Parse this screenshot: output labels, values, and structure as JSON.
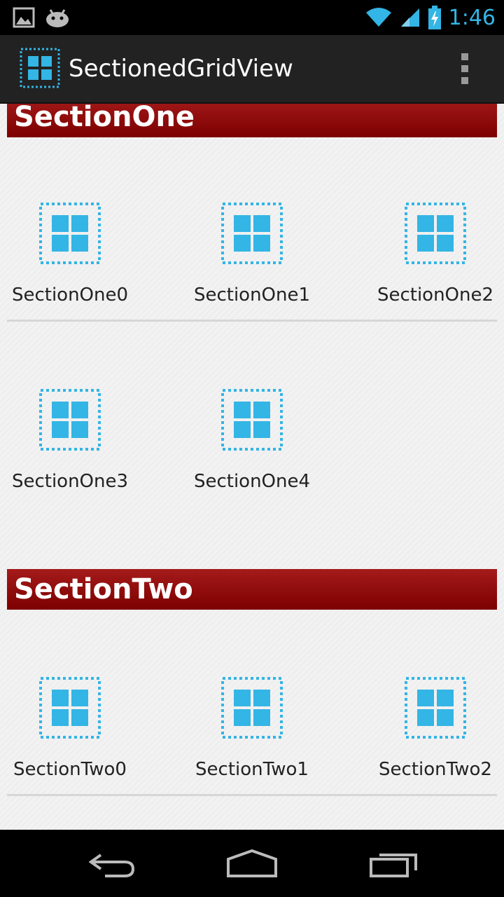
{
  "status_bar": {
    "time": "1:46",
    "icons": [
      "gallery-icon",
      "android-icon",
      "wifi-icon",
      "signal-icon",
      "battery-charging-icon"
    ]
  },
  "action_bar": {
    "title": "SectionedGridView",
    "app_icon": "grid-app-icon",
    "overflow_icon": "overflow-menu-icon"
  },
  "sections": [
    {
      "title": "SectionOne",
      "items": [
        "SectionOne0",
        "SectionOne1",
        "SectionOne2",
        "SectionOne3",
        "SectionOne4"
      ]
    },
    {
      "title": "SectionTwo",
      "items": [
        "SectionTwo0",
        "SectionTwo1",
        "SectionTwo2"
      ]
    }
  ],
  "nav_bar": {
    "back_icon": "back-icon",
    "home_icon": "home-icon",
    "recents_icon": "recents-icon"
  },
  "colors": {
    "accent": "#33b5e5",
    "section_header": "#8b0a0a",
    "action_bar": "#222222",
    "background": "#f2f2f2"
  }
}
